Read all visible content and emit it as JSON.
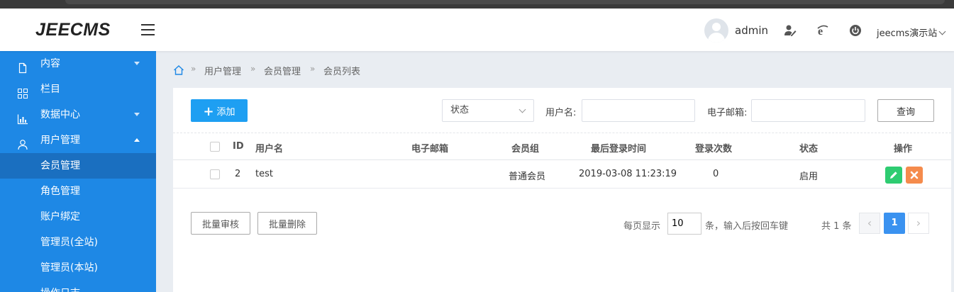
{
  "header": {
    "logo": "JEECMS",
    "user": "admin",
    "site": "jeecms演示站"
  },
  "sidebar": {
    "items": [
      {
        "label": "内容",
        "icon": "document-icon"
      },
      {
        "label": "栏目",
        "icon": "grid-icon"
      },
      {
        "label": "数据中心",
        "icon": "bar-chart-icon"
      },
      {
        "label": "用户管理",
        "icon": "user-icon"
      }
    ],
    "subitems": [
      "会员管理",
      "角色管理",
      "账户绑定",
      "管理员(全站)",
      "管理员(本站)",
      "操作日志"
    ]
  },
  "breadcrumb": [
    "用户管理",
    "会员管理",
    "会员列表"
  ],
  "toolbar": {
    "add_label": "添加",
    "status_placeholder": "状态",
    "username_label": "用户名:",
    "email_label": "电子邮箱:",
    "search_label": "查询"
  },
  "table": {
    "headers": [
      "ID",
      "用户名",
      "电子邮箱",
      "会员组",
      "最后登录时间",
      "登录次数",
      "状态",
      "操作"
    ],
    "rows": [
      {
        "id": "2",
        "username": "test",
        "email": "",
        "group": "普通会员",
        "last_login": "2019-03-08 11:23:19",
        "login_count": "0",
        "status": "启用"
      }
    ]
  },
  "footer": {
    "batch_review": "批量审核",
    "batch_delete": "批量删除",
    "per_page_label": "每页显示",
    "per_page_value": "10",
    "per_page_hint": "条，输入后按回车键",
    "total": "共 1 条",
    "current_page": "1"
  },
  "colors": {
    "sidebar": "#1e88e5",
    "sidebar_active": "#1a6fc0",
    "primary_button": "#1e9ff2",
    "edit": "#2ecc71",
    "delete": "#f58b4c",
    "page_active": "#3a92f0"
  }
}
